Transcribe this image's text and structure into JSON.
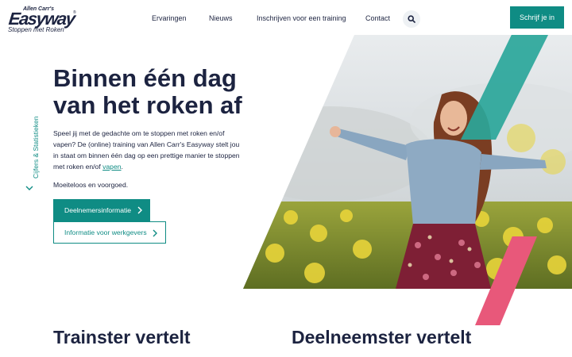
{
  "header": {
    "logo_top": "Allen Carr's",
    "logo_main": "Easyway",
    "logo_reg": "®",
    "logo_sub": "Stoppen met Roken",
    "nav": [
      {
        "label": "Ervaringen"
      },
      {
        "label": "Nieuws"
      },
      {
        "label": "Inschrijven voor een training"
      },
      {
        "label": "Contact"
      }
    ],
    "search_icon": "search-icon",
    "signup_label": "Schrijf je in"
  },
  "hero": {
    "title_line1": "Binnen één dag",
    "title_line2": "van het roken af",
    "text_before_link": "Speel jij met de gedachte om te stoppen met roken en/of vapen? De (online) training van Allen Carr's Easyway stelt jou in staat om binnen één dag op een prettige manier te stoppen met roken en/of ",
    "text_link": "vapen",
    "text_after_link": ".",
    "tagline": "Moeiteloos en voorgoed.",
    "primary_button": "Deelnemersinformatie",
    "secondary_button": "Informatie voor werkgevers"
  },
  "side_link": {
    "label": "Cijfers & Statistieken"
  },
  "sections": {
    "left_title": "Trainster vertelt",
    "right_title": "Deelneemster vertelt"
  },
  "colors": {
    "navy": "#1c2340",
    "teal": "#0f8c84",
    "pink": "#e8587a"
  }
}
